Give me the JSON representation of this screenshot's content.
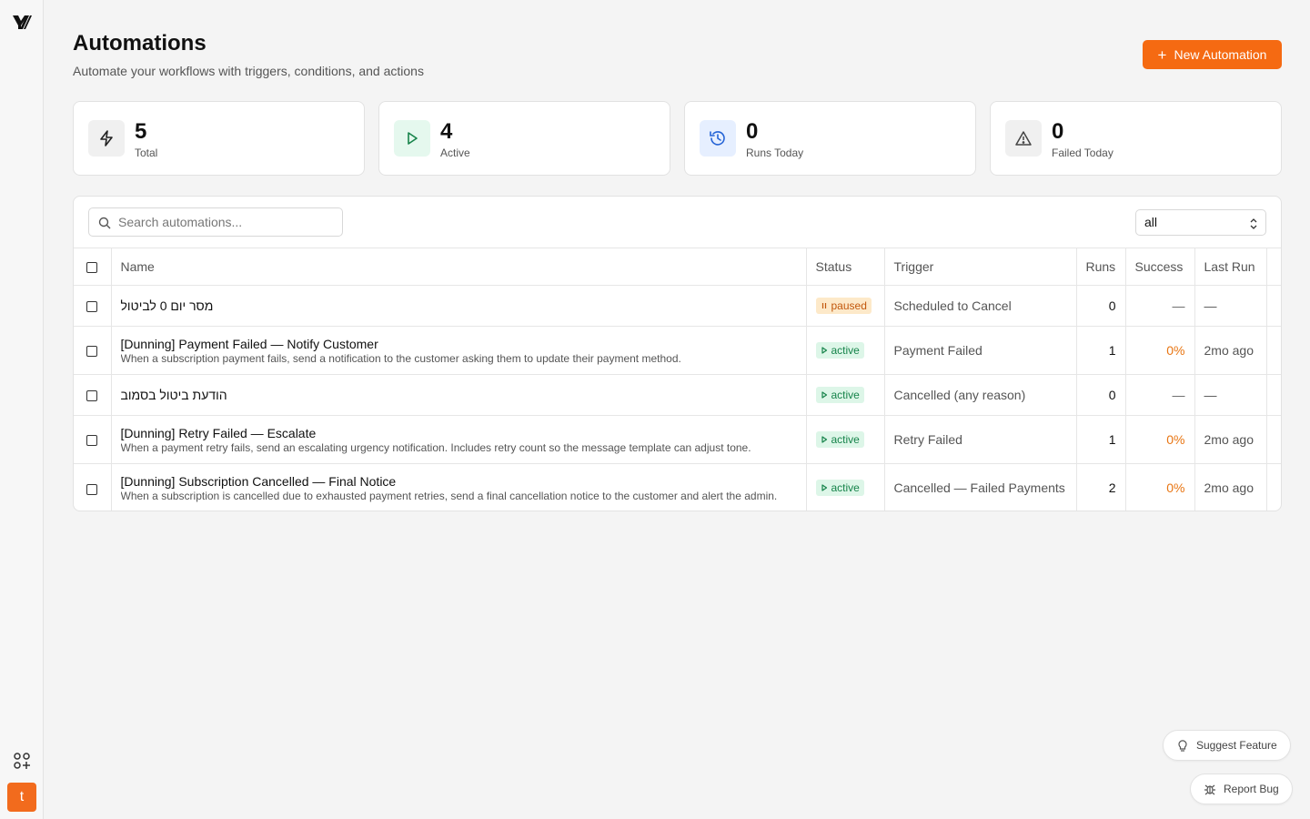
{
  "page": {
    "title": "Automations",
    "subtitle": "Automate your workflows with triggers, conditions, and actions",
    "new_button": "New Automation"
  },
  "sidebar": {
    "avatar_letter": "t"
  },
  "stats": [
    {
      "value": "5",
      "label": "Total",
      "icon": "lightning-icon"
    },
    {
      "value": "4",
      "label": "Active",
      "icon": "play-icon"
    },
    {
      "value": "0",
      "label": "Runs Today",
      "icon": "history-icon"
    },
    {
      "value": "0",
      "label": "Failed Today",
      "icon": "warning-icon"
    }
  ],
  "search": {
    "placeholder": "Search automations..."
  },
  "filter": {
    "selected": "all"
  },
  "table": {
    "headers": {
      "name": "Name",
      "status": "Status",
      "trigger": "Trigger",
      "runs": "Runs",
      "success": "Success",
      "last_run": "Last Run"
    },
    "rows": [
      {
        "name": "מסר יום 0 לביטול",
        "description": "",
        "status": "paused",
        "trigger": "Scheduled to Cancel",
        "runs": "0",
        "success": "—",
        "last_run": "—"
      },
      {
        "name": "[Dunning] Payment Failed — Notify Customer",
        "description": "When a subscription payment fails, send a notification to the customer asking them to update their payment method.",
        "status": "active",
        "trigger": "Payment Failed",
        "runs": "1",
        "success": "0%",
        "last_run": "2mo ago"
      },
      {
        "name": "הודעת ביטול בסמוב",
        "description": "",
        "status": "active",
        "trigger": "Cancelled (any reason)",
        "runs": "0",
        "success": "—",
        "last_run": "—"
      },
      {
        "name": "[Dunning] Retry Failed — Escalate",
        "description": "When a payment retry fails, send an escalating urgency notification. Includes retry count so the message template can adjust tone.",
        "status": "active",
        "trigger": "Retry Failed",
        "runs": "1",
        "success": "0%",
        "last_run": "2mo ago"
      },
      {
        "name": "[Dunning] Subscription Cancelled — Final Notice",
        "description": "When a subscription is cancelled due to exhausted payment retries, send a final cancellation notice to the customer and alert the admin.",
        "status": "active",
        "trigger": "Cancelled — Failed Payments",
        "runs": "2",
        "success": "0%",
        "last_run": "2mo ago"
      }
    ]
  },
  "floating": {
    "suggest": "Suggest Feature",
    "report": "Report Bug"
  },
  "colors": {
    "accent": "#f56a12",
    "active_bg": "#ddf6e8",
    "active_fg": "#16834a",
    "paused_bg": "#fde9c9",
    "paused_fg": "#c2570c"
  }
}
